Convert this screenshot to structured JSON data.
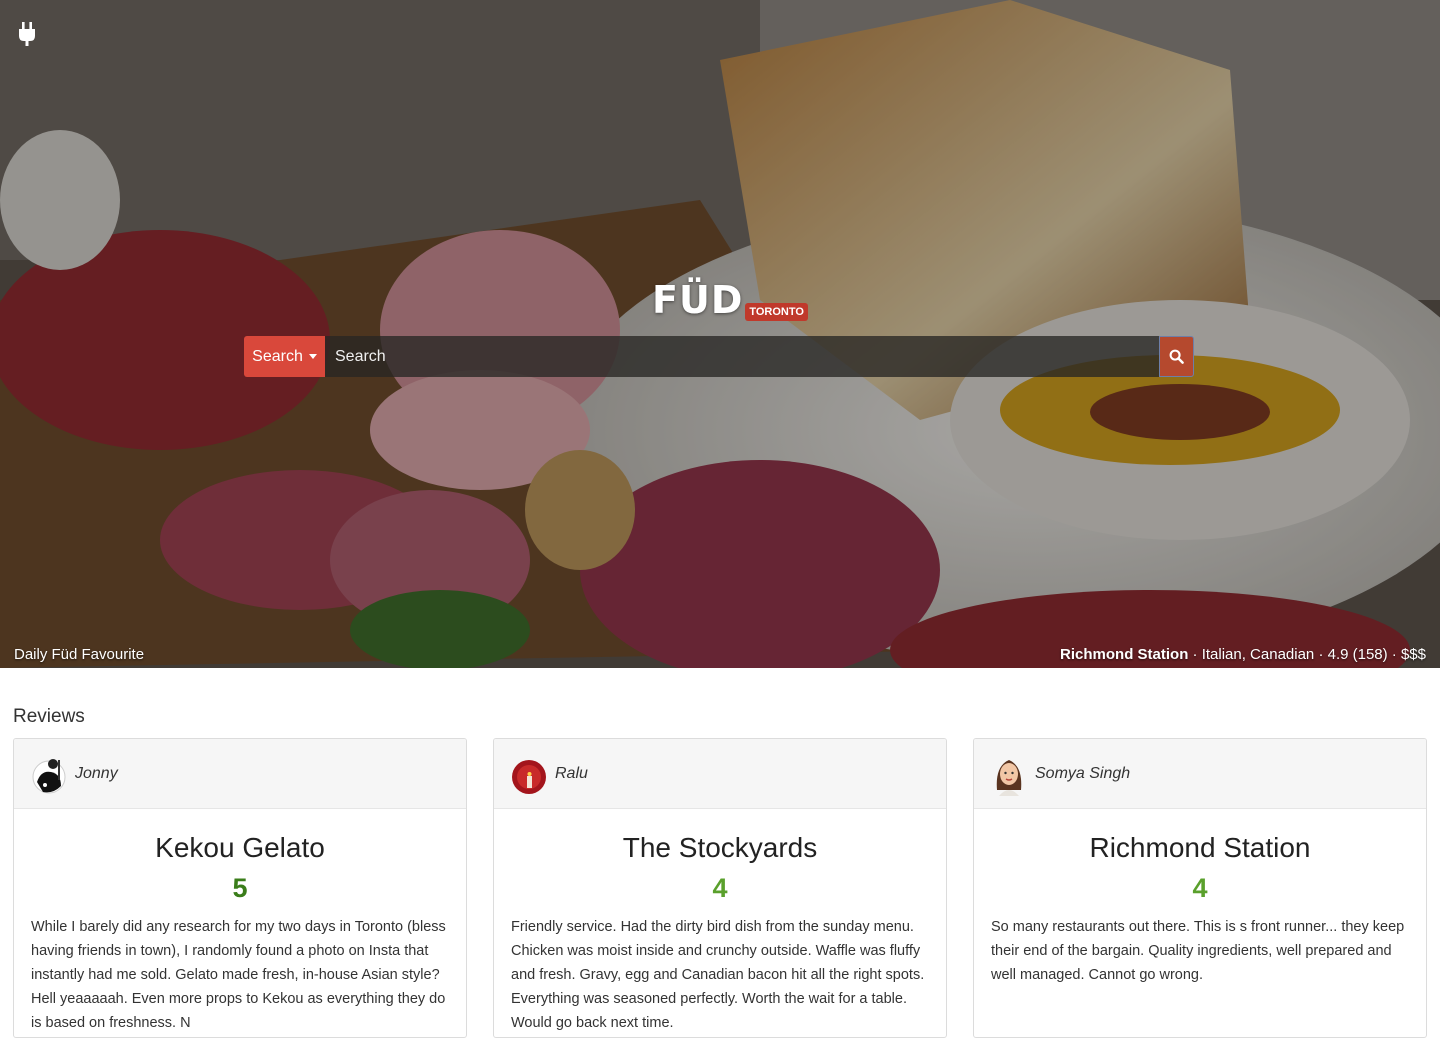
{
  "brand": {
    "name": "FÜD",
    "city": "TORONTO"
  },
  "search": {
    "dropdown_label": "Search",
    "placeholder": "Search",
    "value": ""
  },
  "featured": {
    "label": "Daily Füd Favourite",
    "restaurant": "Richmond Station",
    "details": " · Italian, Canadian · 4.9 (158) · $$$"
  },
  "reviews": {
    "title": "Reviews",
    "items": [
      {
        "user": "Jonny",
        "restaurant": "Kekou Gelato",
        "rating": "5",
        "text": "While I barely did any research for my two days in Toronto (bless having friends in town), I randomly found a photo on Insta that instantly had me sold. Gelato made fresh, in-house Asian style? Hell yeaaaaah. Even more props to Kekou as everything they do is based on freshness. N"
      },
      {
        "user": "Ralu",
        "restaurant": "The Stockyards",
        "rating": "4",
        "text": "Friendly service. Had the dirty bird dish from the sunday menu. Chicken was moist inside and crunchy outside. Waffle was fluffy and fresh. Gravy, egg and Canadian bacon hit all the right spots. Everything was seasoned perfectly. Worth the wait for a table. Would go back next time."
      },
      {
        "user": "Somya Singh",
        "restaurant": "Richmond Station",
        "rating": "4",
        "text": "So many restaurants out there. This is s front runner... they keep their end of the bargain. Quality ingredients, well prepared and well managed. Cannot go wrong."
      }
    ]
  },
  "colors": {
    "accent": "#d9483b",
    "rating_green": "#3a7d1a"
  },
  "icons": {
    "logo": "plug-icon",
    "search": "search-icon"
  }
}
